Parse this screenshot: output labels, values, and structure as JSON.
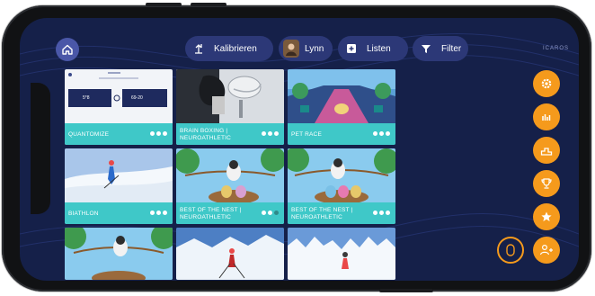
{
  "toolbar": {
    "calibrate_label": "Kalibrieren",
    "user_label": "Lynn",
    "lists_label": "Listen",
    "filter_label": "Filter",
    "brand": "ICAROS"
  },
  "games": [
    {
      "title": "QUANTOMIZE"
    },
    {
      "title": "BRAIN BOXING | NEUROATHLETIC"
    },
    {
      "title": "PET RACE"
    },
    {
      "title": "BIATHLON"
    },
    {
      "title": "BEST OF THE NEST | NEUROATHLETIC"
    },
    {
      "title": "BEST OF THE NEST | NEUROATHLETIC"
    }
  ],
  "quantomize_preview": {
    "left_value": "5*8",
    "right_value": "69-20"
  },
  "colors": {
    "screen_bg": "#152049",
    "pill_bg": "#2c3877",
    "caption": "#3fc8c8",
    "accent": "#f59a1c"
  },
  "side_actions": [
    "gear-icon",
    "chart-icon",
    "podium-icon",
    "trophy-icon",
    "star-icon",
    "users-icon",
    "ring-icon"
  ]
}
